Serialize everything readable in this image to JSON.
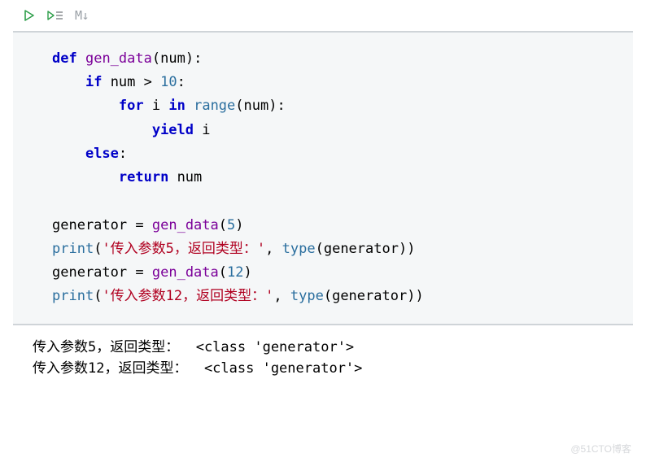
{
  "toolbar": {
    "markdown_label": "M↓"
  },
  "code": {
    "kw_def": "def",
    "fn_name": "gen_data",
    "param": "num",
    "kw_if": "if",
    "cond_num": "num",
    "op_gt": ">",
    "lit_10": "10",
    "kw_for": "for",
    "var_i": "i",
    "kw_in": "in",
    "bi_range": "range",
    "range_arg": "num",
    "kw_yield": "yield",
    "yield_val": "i",
    "kw_else": "else",
    "kw_return": "return",
    "return_val": "num",
    "var_gen": "generator",
    "assign": "=",
    "call1_arg": "5",
    "call2_arg": "12",
    "bi_print": "print",
    "str1": "'传入参数5，返回类型：'",
    "str2": "'传入参数12，返回类型：'",
    "comma": ", ",
    "bi_type": "type",
    "type_arg": "generator"
  },
  "output": {
    "line1": "传入参数5，返回类型：  <class 'generator'>",
    "line2": "传入参数12，返回类型：  <class 'generator'>"
  },
  "watermark": "@51CTO博客"
}
